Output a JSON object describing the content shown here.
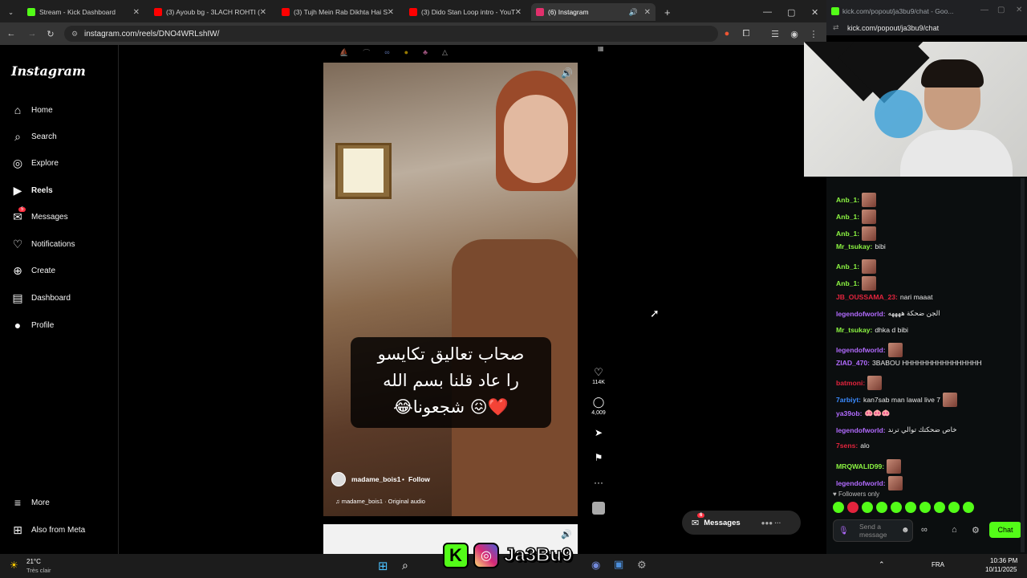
{
  "browser": {
    "tabs": [
      {
        "title": "Stream - Kick Dashboard",
        "color": "#53fc18"
      },
      {
        "title": "(3) Ayoub bg - 3LACH ROHTI (",
        "color": "#ff0000"
      },
      {
        "title": "(3) Tujh Mein Rab Dikhta Hai S",
        "color": "#ff0000"
      },
      {
        "title": "(3) Dido Stan Loop intro - YouT",
        "color": "#ff0000"
      },
      {
        "title": "(6) Instagram",
        "color": "#e1306c"
      }
    ],
    "url": "instagram.com/reels/DNO4WRLshIW/"
  },
  "popout": {
    "title": "kick.com/popout/ja3bu9/chat - Goo...",
    "url": "kick.com/popout/ja3bu9/chat"
  },
  "instagram": {
    "logo": "Instagram",
    "nav": [
      {
        "label": "Home",
        "icon": "home-icon"
      },
      {
        "label": "Search",
        "icon": "search-icon"
      },
      {
        "label": "Explore",
        "icon": "compass-icon"
      },
      {
        "label": "Reels",
        "icon": "reels-icon"
      },
      {
        "label": "Messages",
        "icon": "messenger-icon",
        "badge": "5"
      },
      {
        "label": "Notifications",
        "icon": "heart-icon"
      },
      {
        "label": "Create",
        "icon": "plus-square-icon"
      },
      {
        "label": "Dashboard",
        "icon": "dashboard-icon"
      },
      {
        "label": "Profile",
        "icon": "avatar-icon"
      }
    ],
    "more": "More",
    "meta": "Also from Meta",
    "reel": {
      "caption_lines": [
        "صحاب تعاليق تكايسو",
        "را عاد قلنا بسم الله",
        "❤️😖 شجعونا😂"
      ],
      "author": "madame_bois1",
      "follow": "Follow",
      "audio": "madame_bois1 · Original audio",
      "likes": "114K",
      "comments": "4,009"
    },
    "messages_button": "Messages",
    "messages_badge": "6"
  },
  "chat": {
    "messages": [
      {
        "user": "Anb_1:",
        "color": "#8cf542",
        "text": "",
        "emote": true
      },
      {
        "user": "Anb_1:",
        "color": "#8cf542",
        "text": "",
        "emote": true
      },
      {
        "user": "Anb_1:",
        "color": "#8cf542",
        "text": "",
        "emote": true
      },
      {
        "user": "Mr_tsukay:",
        "color": "#8cf542",
        "text": "bibi",
        "emote": false
      },
      {
        "user": "Anb_1:",
        "color": "#8cf542",
        "text": "",
        "emote": true
      },
      {
        "user": "Anb_1:",
        "color": "#8cf542",
        "text": "",
        "emote": true
      },
      {
        "user": "JB_OUSSAMA_23:",
        "color": "#e3243d",
        "text": "nari maaat",
        "emote": false
      },
      {
        "user": "legendofworld:",
        "color": "#b26bff",
        "text": "الجن ضحكة ههههه",
        "emote": false
      },
      {
        "user": "Mr_tsukay:",
        "color": "#8cf542",
        "text": "dhka d bibi",
        "emote": false
      },
      {
        "user": "legendofworld:",
        "color": "#b26bff",
        "text": "",
        "emote": true
      },
      {
        "user": "ZIAD_470:",
        "color": "#b26bff",
        "text": "3BABOU HHHHHHHHHHHHHHHH",
        "emote": false
      },
      {
        "user": "batmoni:",
        "color": "#e3243d",
        "text": "",
        "emote": true
      },
      {
        "user": "7arbiyt:",
        "color": "#3b8bff",
        "text": "kan7sab man lawal live 7",
        "emote": true
      },
      {
        "user": "ya39ob:",
        "color": "#b26bff",
        "text": "🐽🐽🐽",
        "emote": false
      },
      {
        "user": "legendofworld:",
        "color": "#b26bff",
        "text": "خاص ضحكتك توالي ترند",
        "emote": false
      },
      {
        "user": "7sens:",
        "color": "#e3243d",
        "text": "alo",
        "emote": false
      },
      {
        "user": "MRQWALID99:",
        "color": "#8cf542",
        "text": "",
        "emote": true
      },
      {
        "user": "legendofworld:",
        "color": "#b26bff",
        "text": "",
        "emote": true
      }
    ],
    "followers_only": "Followers only",
    "send_placeholder": "Send a message",
    "chat_button": "Chat"
  },
  "overlay": {
    "name": "Ja3Bu9"
  },
  "taskbar": {
    "temp": "21°C",
    "weather": "Très clair",
    "lang": "FRA",
    "time": "10:36 PM",
    "date": "10/11/2025"
  }
}
